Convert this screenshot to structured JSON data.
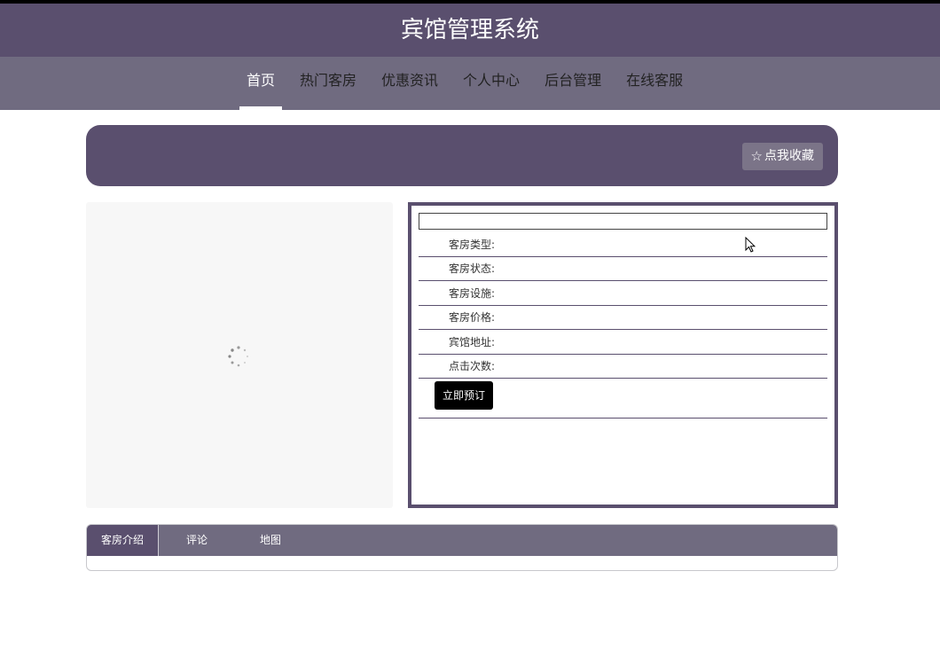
{
  "header": {
    "title": "宾馆管理系统"
  },
  "nav": {
    "items": [
      {
        "label": "首页",
        "active": true
      },
      {
        "label": "热门客房",
        "active": false
      },
      {
        "label": "优惠资讯",
        "active": false
      },
      {
        "label": "个人中心",
        "active": false
      },
      {
        "label": "后台管理",
        "active": false
      },
      {
        "label": "在线客服",
        "active": false
      }
    ]
  },
  "banner": {
    "favorite_label": "点我收藏",
    "favorite_icon": "star-outline-icon"
  },
  "room_image": {
    "state_icon": "loading-spinner-icon"
  },
  "room_info": {
    "title": "",
    "fields": [
      {
        "label": "客房类型:",
        "value": ""
      },
      {
        "label": "客房状态:",
        "value": ""
      },
      {
        "label": "客房设施:",
        "value": ""
      },
      {
        "label": "客房价格:",
        "value": ""
      },
      {
        "label": "宾馆地址:",
        "value": ""
      },
      {
        "label": "点击次数:",
        "value": ""
      }
    ],
    "book_label": "立即预订"
  },
  "tabs": {
    "items": [
      {
        "label": "客房介绍",
        "active": true
      },
      {
        "label": "评论",
        "active": false
      },
      {
        "label": "地图",
        "active": false
      }
    ]
  },
  "colors": {
    "primary": "#5a4f6e",
    "secondary": "#706b80",
    "button": "#000000"
  }
}
